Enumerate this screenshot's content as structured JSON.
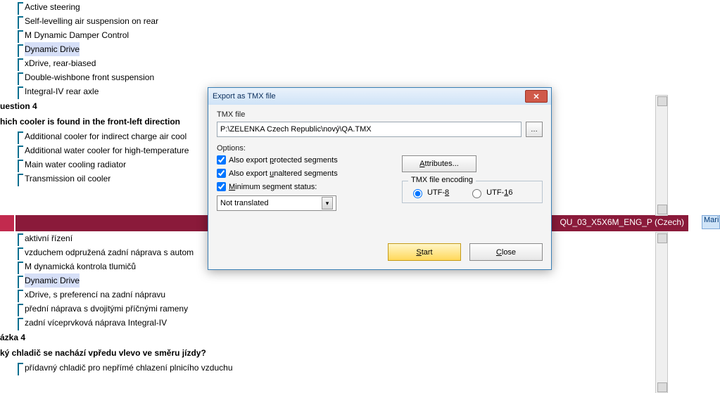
{
  "doc_upper": {
    "items": [
      {
        "text": "Active steering",
        "hl": false
      },
      {
        "text": "Self-levelling air suspension on rear",
        "hl": false
      },
      {
        "text": "M Dynamic Damper Control",
        "hl": false
      },
      {
        "text": "Dynamic Drive",
        "hl": true
      },
      {
        "text": "xDrive, rear-biased",
        "hl": false
      },
      {
        "text": "Double-wishbone front suspension",
        "hl": false
      },
      {
        "text": "Integral-IV rear axle",
        "hl": false
      }
    ],
    "heading1": "uestion 4",
    "heading2": "hich cooler is found in the front-left direction",
    "items2": [
      {
        "text": "Additional cooler for indirect charge air cool"
      },
      {
        "text": "Additional water cooler for high-temperature"
      },
      {
        "text": "Main water cooling radiator"
      },
      {
        "text": "Transmission oil cooler"
      }
    ]
  },
  "bar": {
    "file_label": "QU_03_X5X6M_ENG_P (Czech)"
  },
  "doc_lower": {
    "items": [
      {
        "text": "aktivní řízení",
        "hl": false
      },
      {
        "text": "vzduchem odpružená zadní náprava s autom",
        "hl": false
      },
      {
        "text": "M dynamická kontrola tlumičů",
        "hl": false
      },
      {
        "text": "Dynamic Drive",
        "hl": true
      },
      {
        "text": "xDrive, s preferencí na zadní nápravu",
        "hl": false
      },
      {
        "text": "přední náprava s dvojitými příčnými rameny",
        "hl": false
      },
      {
        "text": "zadní víceprvková náprava Integral-IV",
        "hl": false
      }
    ],
    "heading1": "ázka 4",
    "heading2": "ký chladič se nachází vpředu vlevo ve směru jízdy?",
    "items2": [
      {
        "text": "přídavný chladič pro nepřímé chlazení plnicího vzduchu"
      }
    ]
  },
  "dialog": {
    "title": "Export as TMX file",
    "tmx_file_label": "TMX file",
    "path": "P:\\ZELENKA Czech Republic\\nový\\QA.TMX",
    "options_label": "Options:",
    "chk1_pre": "Also export ",
    "chk1_ul": "p",
    "chk1_post": "rotected segments",
    "chk2_pre": "Also export ",
    "chk2_ul": "u",
    "chk2_post": "naltered segments",
    "chk3_ul": "M",
    "chk3_post": "inimum segment status:",
    "select_value": "Not translated",
    "attributes_btn_ul": "A",
    "attributes_btn_post": "ttributes...",
    "encoding_legend": "TMX file encoding",
    "radio1_pre": "UTF-",
    "radio1_ul": "8",
    "radio2_pre": "UTF-",
    "radio2_ul": "1",
    "radio2_post": "6",
    "start_ul": "S",
    "start_post": "tart",
    "close_ul": "C",
    "close_post": "lose"
  },
  "mari_tag": "Mari"
}
